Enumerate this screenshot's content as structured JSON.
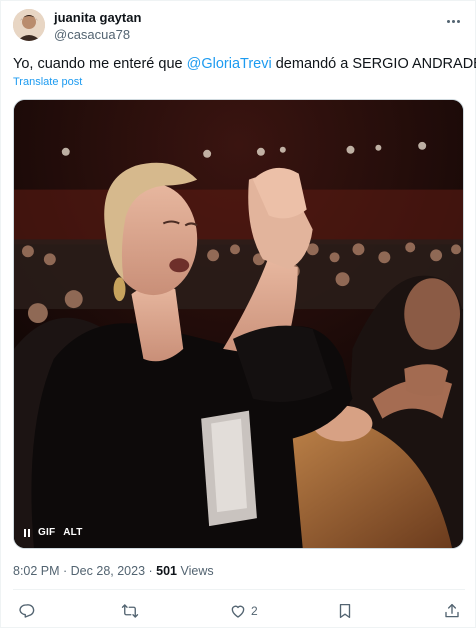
{
  "author": {
    "display_name": "juanita gaytan",
    "handle": "@casacua78"
  },
  "tweet": {
    "text_before": "Yo, cuando me enteré que ",
    "mention": "@GloriaTrevi",
    "text_after": " demandó a SERGIO ANDRADE",
    "translate_label": "Translate post"
  },
  "media": {
    "gif_label": "GIF",
    "alt_label": "ALT"
  },
  "meta": {
    "timestamp": "8:02 PM · Dec 28, 2023 · ",
    "views_count": "501",
    "views_label": " Views"
  },
  "actions": {
    "reply_count": "",
    "repost_count": "",
    "like_count": "2"
  },
  "colors": {
    "accent": "#1d9bf0",
    "secondary_text": "#536471"
  },
  "icons": [
    "more-icon",
    "reply-icon",
    "repost-icon",
    "like-icon",
    "bookmark-icon",
    "share-icon",
    "pause-icon"
  ]
}
